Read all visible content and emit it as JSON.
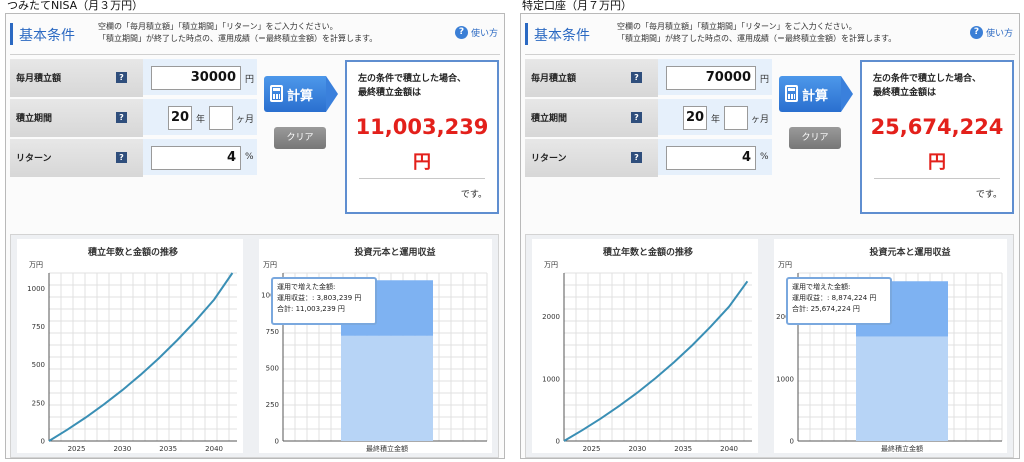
{
  "panels": [
    {
      "caption": "つみたてNISA（月３万円）",
      "header": {
        "title": "基本条件",
        "note_line1": "空欄の「毎月積立額」「積立期間」「リターン」をご入力ください。",
        "note_line2": "「積立期間」が終了した時点の、運用成績（＝最終積立金額）を計算します。",
        "help_icon": "question-icon",
        "help_label": "使い方"
      },
      "form": {
        "monthly_label": "毎月積立額",
        "monthly_value": "30000",
        "monthly_unit": "円",
        "period_label": "積立期間",
        "period_years": "20",
        "period_years_unit": "年",
        "period_months": "",
        "period_months_unit": "ヶ月",
        "return_label": "リターン",
        "return_value": "4",
        "return_unit": "%",
        "help_icon": "question-icon"
      },
      "buttons": {
        "calc_label": "計算",
        "calc_icon": "calculator-icon",
        "clear_label": "クリア"
      },
      "result": {
        "lead_line1": "左の条件で積立した場合、",
        "lead_line2": "最終積立金額は",
        "amount": "11,003,239",
        "currency": "円",
        "tail": "です。"
      },
      "tooltip": {
        "line1": "運用で増えた金額:",
        "line2": "運用収益：: 3,803,239 円",
        "line3": "合計: 11,003,239 円"
      },
      "chart_data": [
        {
          "type": "line",
          "title": "積立年数と金額の推移",
          "ylabel": "万円",
          "xlim": [
            2022,
            2042.5
          ],
          "ylim": [
            0,
            1100
          ],
          "xticks": [
            2025,
            2030,
            2035,
            2040
          ],
          "yticks": [
            0,
            250,
            500,
            750,
            1000
          ],
          "grid": true,
          "series": [
            {
              "color": "#3a8fb5",
              "x": [
                2022,
                2024,
                2026,
                2028,
                2030,
                2032,
                2034,
                2036,
                2038,
                2040,
                2042
              ],
              "y": [
                0,
                74,
                154,
                240,
                333,
                434,
                543,
                661,
                788,
                926,
                1100
              ]
            }
          ]
        },
        {
          "type": "bar",
          "title": "投資元本と運用収益",
          "ylabel": "万円",
          "categories": [
            "最終積立金額"
          ],
          "ylim": [
            0,
            1150
          ],
          "yticks": [
            0,
            250,
            500,
            750,
            1000
          ],
          "grid": true,
          "series": [
            {
              "values": [
                720
              ],
              "color": "#b7d4f6"
            },
            {
              "values": [
                380.3239
              ],
              "color": "#7eb2f2"
            }
          ]
        }
      ]
    },
    {
      "caption": "特定口座（月７万円）",
      "header": {
        "title": "基本条件",
        "note_line1": "空欄の「毎月積立額」「積立期間」「リターン」をご入力ください。",
        "note_line2": "「積立期間」が終了した時点の、運用成績（＝最終積立金額）を計算します。",
        "help_icon": "question-icon",
        "help_label": "使い方"
      },
      "form": {
        "monthly_label": "毎月積立額",
        "monthly_value": "70000",
        "monthly_unit": "円",
        "period_label": "積立期間",
        "period_years": "20",
        "period_years_unit": "年",
        "period_months": "",
        "period_months_unit": "ヶ月",
        "return_label": "リターン",
        "return_value": "4",
        "return_unit": "%",
        "help_icon": "question-icon"
      },
      "buttons": {
        "calc_label": "計算",
        "calc_icon": "calculator-icon",
        "clear_label": "クリア"
      },
      "result": {
        "lead_line1": "左の条件で積立した場合、",
        "lead_line2": "最終積立金額は",
        "amount": "25,674,224",
        "currency": "円",
        "tail": "です。"
      },
      "tooltip": {
        "line1": "運用で増えた金額:",
        "line2": "運用収益：: 8,874,224 円",
        "line3": "合計: 25,674,224 円"
      },
      "chart_data": [
        {
          "type": "line",
          "title": "積立年数と金額の推移",
          "ylabel": "万円",
          "xlim": [
            2022,
            2042.5
          ],
          "ylim": [
            0,
            2700
          ],
          "xticks": [
            2025,
            2030,
            2035,
            2040
          ],
          "yticks": [
            0,
            1000,
            2000
          ],
          "grid": true,
          "series": [
            {
              "color": "#3a8fb5",
              "x": [
                2022,
                2024,
                2026,
                2028,
                2030,
                2032,
                2034,
                2036,
                2038,
                2040,
                2042
              ],
              "y": [
                0,
                174,
                360,
                561,
                778,
                1012,
                1266,
                1541,
                1838,
                2160,
                2567
              ]
            }
          ]
        },
        {
          "type": "bar",
          "title": "投資元本と運用収益",
          "ylabel": "万円",
          "categories": [
            "最終積立金額"
          ],
          "ylim": [
            0,
            2700
          ],
          "yticks": [
            0,
            1000,
            2000
          ],
          "grid": true,
          "series": [
            {
              "values": [
                1680
              ],
              "color": "#b7d4f6"
            },
            {
              "values": [
                887.4224
              ],
              "color": "#7eb2f2"
            }
          ]
        }
      ]
    }
  ]
}
